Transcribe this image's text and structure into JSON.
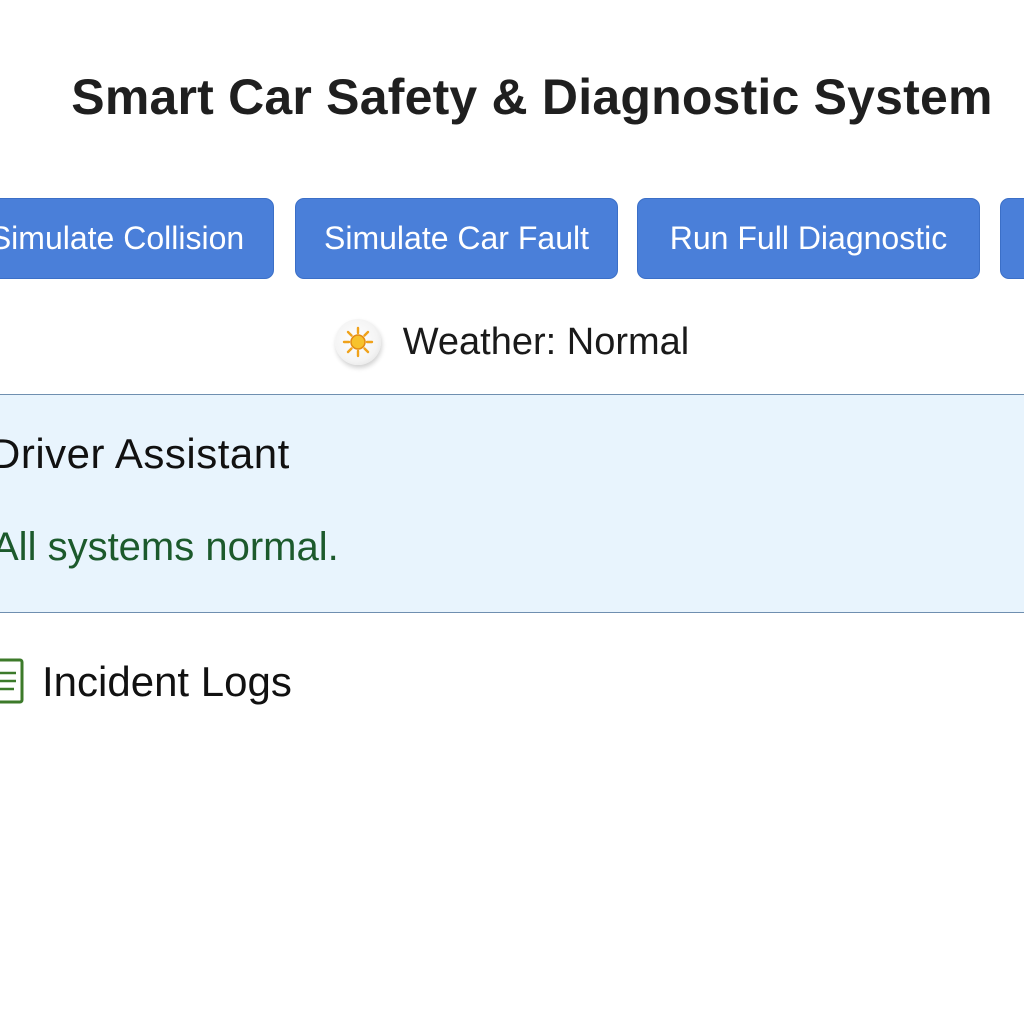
{
  "header": {
    "title": "Smart Car Safety & Diagnostic System"
  },
  "actions": {
    "collision_label": "Simulate Collision",
    "fault_label": "Simulate Car Fault",
    "diagnostic_label": "Run Full Diagnostic",
    "extra_label": ""
  },
  "weather": {
    "icon": "sun-icon",
    "text": "Weather: Normal"
  },
  "assistant": {
    "title": "Driver Assistant",
    "status": "All systems normal.",
    "status_color": "#1c5a2c",
    "background_color": "#e8f4fd"
  },
  "logs": {
    "icon": "log-icon",
    "title": "Incident Logs"
  },
  "colors": {
    "button": "#4a7fd9",
    "button_text": "#ffffff"
  }
}
